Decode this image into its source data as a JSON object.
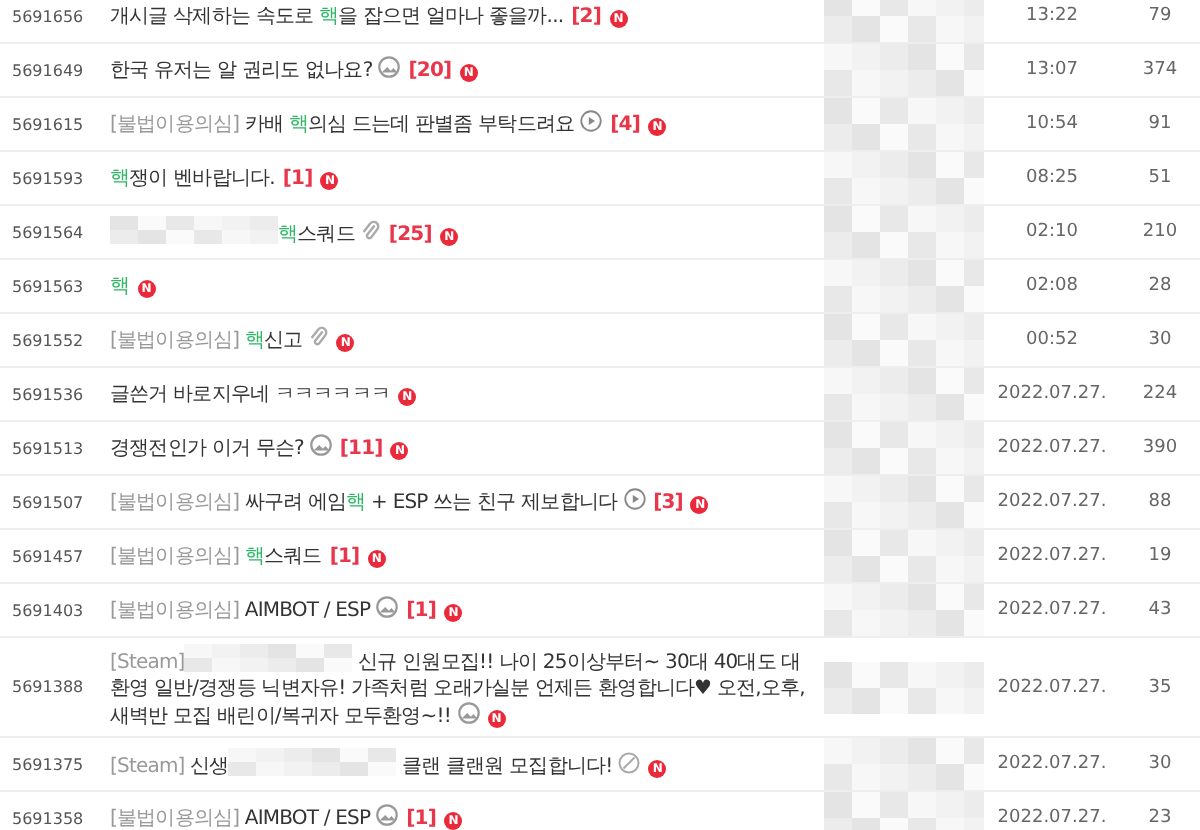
{
  "rows": [
    {
      "id": "5691656",
      "title": [
        {
          "kind": "text",
          "text": "개시글 삭제하는 속도로 "
        },
        {
          "kind": "hack",
          "text": "핵"
        },
        {
          "kind": "text",
          "text": "을 잡으면 얼마나 좋을까..."
        }
      ],
      "comments": "[2]",
      "badge": "N",
      "author_blurred": true,
      "date": "13:22",
      "views": "79"
    },
    {
      "id": "5691649",
      "title": [
        {
          "kind": "text",
          "text": "한국 유저는 알 권리도 없나요?"
        }
      ],
      "icon": {
        "kind": "image"
      },
      "comments": "[20]",
      "badge": "N",
      "author_blurred": true,
      "date": "13:07",
      "views": "374"
    },
    {
      "id": "5691615",
      "title": [
        {
          "kind": "prefix",
          "text": "[불법이용의심]"
        },
        {
          "kind": "text",
          "text": " 카배 "
        },
        {
          "kind": "hack",
          "text": "핵"
        },
        {
          "kind": "text",
          "text": "의심 드는데 판별좀 부탁드려요"
        }
      ],
      "icon": {
        "kind": "video"
      },
      "comments": "[4]",
      "badge": "N",
      "author_blurred": true,
      "date": "10:54",
      "views": "91"
    },
    {
      "id": "5691593",
      "title": [
        {
          "kind": "hack",
          "text": "핵"
        },
        {
          "kind": "text",
          "text": "쟁이 벤바랍니다."
        }
      ],
      "comments": "[1]",
      "badge": "N",
      "author_blurred": true,
      "date": "08:25",
      "views": "51"
    },
    {
      "id": "5691564",
      "title": [
        {
          "kind": "blur"
        },
        {
          "kind": "hack",
          "text": "핵"
        },
        {
          "kind": "text",
          "text": "스쿼드"
        }
      ],
      "icon": {
        "kind": "attachment"
      },
      "comments": "[25]",
      "badge": "N",
      "author_blurred": true,
      "date": "02:10",
      "views": "210"
    },
    {
      "id": "5691563",
      "title": [
        {
          "kind": "hack",
          "text": "핵"
        }
      ],
      "badge": "N",
      "author_blurred": true,
      "date": "02:08",
      "views": "28"
    },
    {
      "id": "5691552",
      "title": [
        {
          "kind": "prefix",
          "text": "[불법이용의심] "
        },
        {
          "kind": "hack",
          "text": "핵"
        },
        {
          "kind": "text",
          "text": "신고"
        }
      ],
      "icon": {
        "kind": "attachment"
      },
      "badge": "N",
      "author_blurred": true,
      "date": "00:52",
      "views": "30"
    },
    {
      "id": "5691536",
      "title": [
        {
          "kind": "text",
          "text": "글쓴거 바로지우네 ㅋㅋㅋㅋㅋㅋ"
        }
      ],
      "badge": "N",
      "author_blurred": true,
      "date": "2022.07.27.",
      "views": "224"
    },
    {
      "id": "5691513",
      "title": [
        {
          "kind": "text",
          "text": "경쟁전인가 이거 무슨?"
        }
      ],
      "icon": {
        "kind": "image"
      },
      "comments": "[11]",
      "badge": "N",
      "author_blurred": true,
      "date": "2022.07.27.",
      "views": "390"
    },
    {
      "id": "5691507",
      "title": [
        {
          "kind": "prefix",
          "text": "[불법이용의심]"
        },
        {
          "kind": "text",
          "text": " 싸구려 에임"
        },
        {
          "kind": "hack",
          "text": "핵"
        },
        {
          "kind": "text",
          "text": " + ESP 쓰는 친구 제보합니다"
        }
      ],
      "icon": {
        "kind": "video"
      },
      "comments": "[3]",
      "badge": "N",
      "author_blurred": true,
      "date": "2022.07.27.",
      "views": "88"
    },
    {
      "id": "5691457",
      "title": [
        {
          "kind": "prefix",
          "text": "[불법이용의심] "
        },
        {
          "kind": "hack",
          "text": "핵"
        },
        {
          "kind": "text",
          "text": "스쿼드"
        }
      ],
      "comments": "[1]",
      "badge": "N",
      "author_blurred": true,
      "date": "2022.07.27.",
      "views": "19"
    },
    {
      "id": "5691403",
      "title": [
        {
          "kind": "prefix",
          "text": "[불법이용의심]"
        },
        {
          "kind": "text",
          "text": " AIMBOT / ESP"
        }
      ],
      "icon": {
        "kind": "image"
      },
      "comments": "[1]",
      "badge": "N",
      "author_blurred": true,
      "date": "2022.07.27.",
      "views": "43"
    },
    {
      "id": "5691388",
      "title": [
        {
          "kind": "prefix",
          "text": "[Steam]"
        },
        {
          "kind": "blur"
        },
        {
          "kind": "text",
          "text": " 신규 인원모집!! 나이 25이상부터~ 30대 40대도 대환영 일반/경쟁등 닉변자유! 가족처럼 오래가실분 언제든 환영합니다♥ 오전,오후,새벽반 모집 배린이/복귀자 모두환영~!!"
        }
      ],
      "icon": {
        "kind": "image"
      },
      "badge": "N",
      "author_blurred": true,
      "date": "2022.07.27.",
      "views": "35"
    },
    {
      "id": "5691375",
      "title": [
        {
          "kind": "prefix",
          "text": "[Steam]"
        },
        {
          "kind": "text",
          "text": " 신생"
        },
        {
          "kind": "blur"
        },
        {
          "kind": "text",
          "text": " 클랜 클랜원 모집합니다!"
        }
      ],
      "icon": {
        "kind": "blocked"
      },
      "badge": "N",
      "author_blurred": true,
      "date": "2022.07.27.",
      "views": "30"
    },
    {
      "id": "5691358",
      "title": [
        {
          "kind": "prefix",
          "text": "[불법이용의심]"
        },
        {
          "kind": "text",
          "text": " AIMBOT / ESP"
        }
      ],
      "icon": {
        "kind": "image"
      },
      "comments": "[1]",
      "badge": "N",
      "author_blurred": true,
      "date": "2022.07.27.",
      "views": "23"
    }
  ]
}
